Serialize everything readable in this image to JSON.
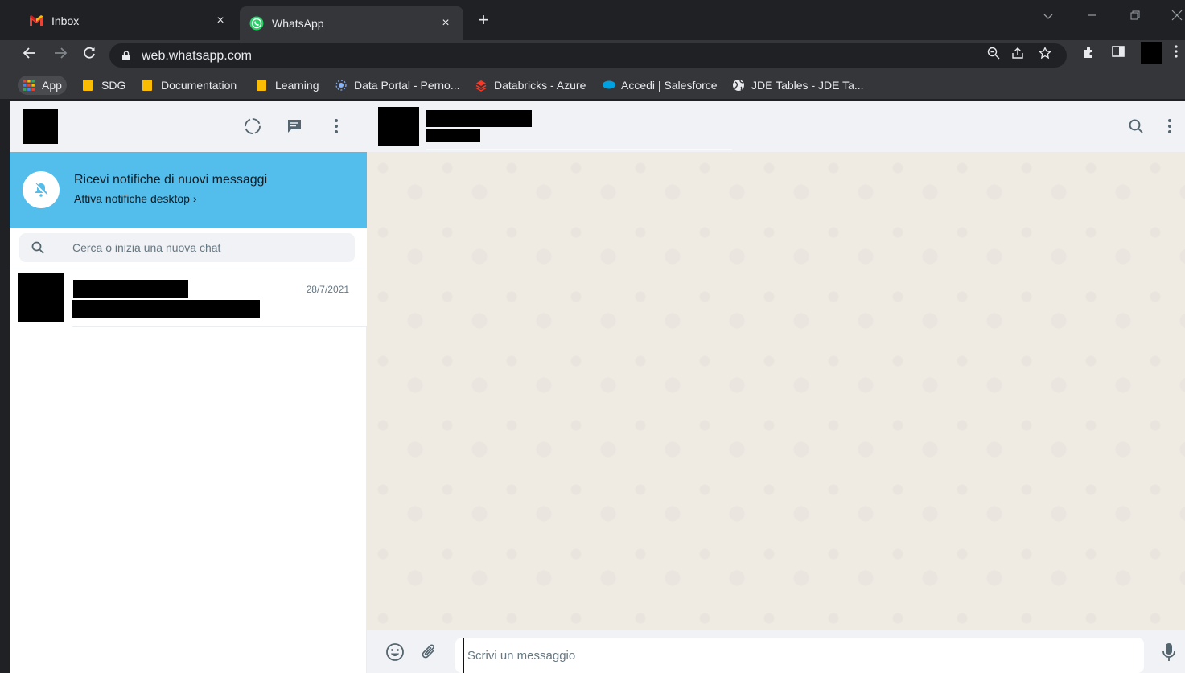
{
  "browser": {
    "tabs": [
      {
        "label": "Inbox",
        "icon": "gmail-icon",
        "close": "×"
      },
      {
        "label": "WhatsApp",
        "icon": "whatsapp-icon",
        "close": "×"
      }
    ],
    "new_tab": "+",
    "url": "web.whatsapp.com",
    "bookmarks": [
      {
        "label": "App",
        "icon": "apps-grid-icon"
      },
      {
        "label": "SDG",
        "icon": "folder-icon"
      },
      {
        "label": "Documentation",
        "icon": "folder-icon"
      },
      {
        "label": "Learning",
        "icon": "folder-icon"
      },
      {
        "label": "Data Portal - Perno...",
        "icon": "data-portal-icon"
      },
      {
        "label": "Databricks - Azure",
        "icon": "databricks-icon"
      },
      {
        "label": "Accedi | Salesforce",
        "icon": "salesforce-icon"
      },
      {
        "label": "JDE Tables - JDE Ta...",
        "icon": "globe-icon"
      }
    ]
  },
  "whatsapp": {
    "notification": {
      "title": "Ricevi notifiche di nuovi messaggi",
      "subtitle": "Attiva notifiche desktop ›"
    },
    "search": {
      "placeholder": "Cerca o inizia una nuova chat"
    },
    "chats": [
      {
        "date": "28/7/2021"
      }
    ],
    "composer": {
      "placeholder": "Scrivi un messaggio"
    }
  },
  "colors": {
    "notification_bg": "#53bdeb",
    "header_bg": "#f0f2f5",
    "conversation_bg": "#efeae2",
    "browser_dark": "#202124"
  }
}
